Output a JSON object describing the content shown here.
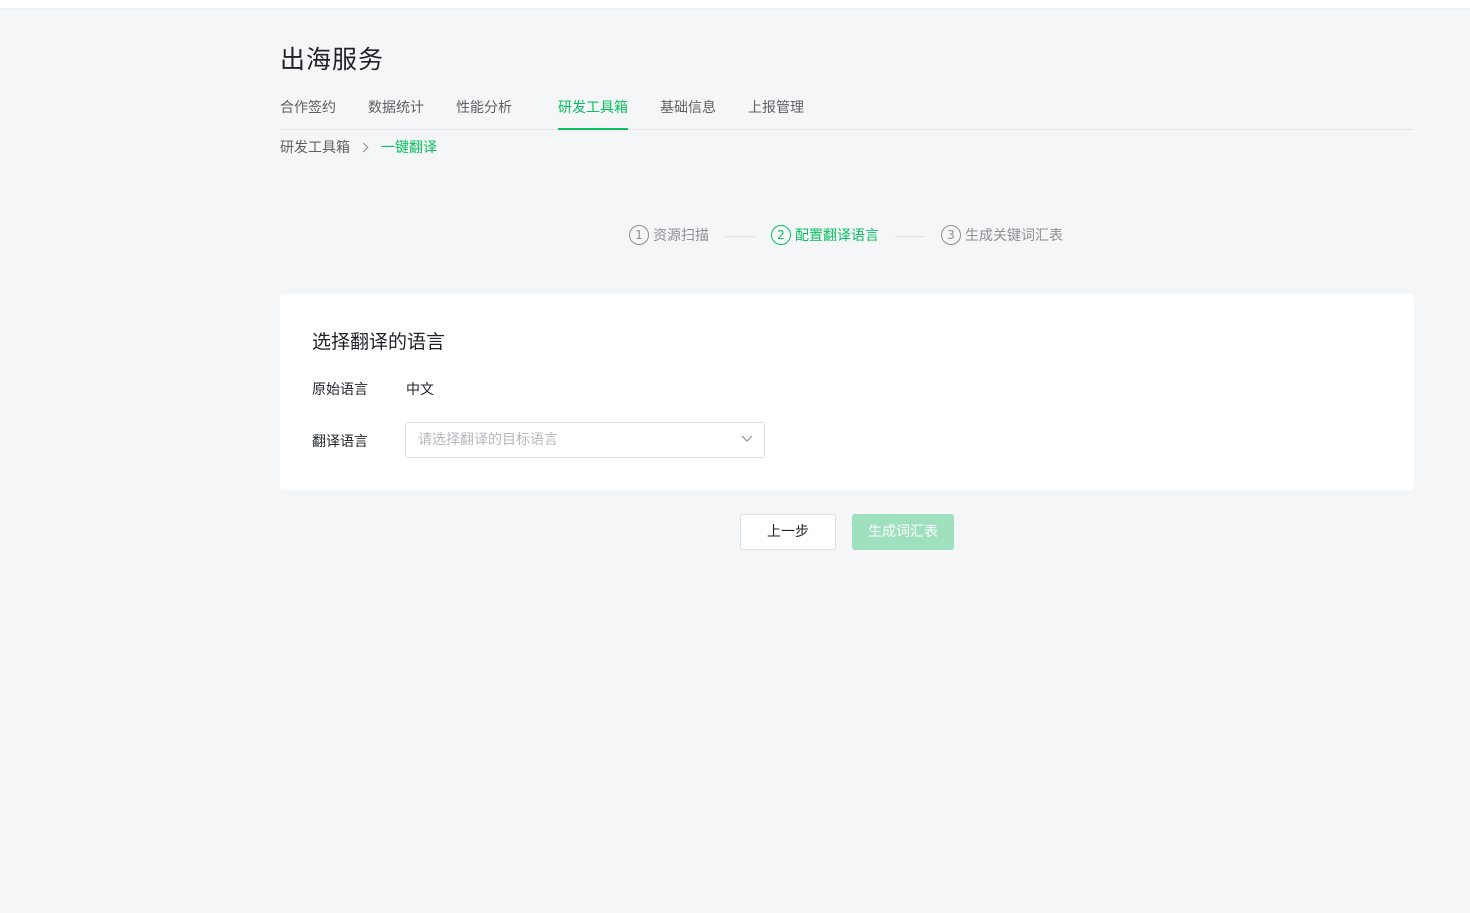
{
  "page": {
    "title": "出海服务"
  },
  "tabs": [
    {
      "label": "合作签约"
    },
    {
      "label": "数据统计"
    },
    {
      "label": "性能分析"
    },
    {
      "label": "研发工具箱"
    },
    {
      "label": "基础信息"
    },
    {
      "label": "上报管理"
    }
  ],
  "active_tab": "研发工具箱",
  "breadcrumb": {
    "parent": "研发工具箱",
    "current": "一键翻译"
  },
  "steps": [
    {
      "number": "1",
      "label": "资源扫描",
      "state": "done"
    },
    {
      "number": "2",
      "label": "配置翻译语言",
      "state": "active"
    },
    {
      "number": "3",
      "label": "生成关键词汇表",
      "state": "pending"
    }
  ],
  "card": {
    "title": "选择翻译的语言",
    "source_label": "原始语言",
    "source_value": "中文",
    "target_label": "翻译语言",
    "target_placeholder": "请选择翻译的目标语言"
  },
  "buttons": {
    "prev": "上一步",
    "generate": "生成词汇表"
  },
  "colors": {
    "accent": "#07c160",
    "accent_disabled": "#9be0bc",
    "background": "#f5f6f7"
  },
  "icons": {
    "breadcrumb_separator": "chevron-right-icon",
    "select_arrow": "chevron-down-icon"
  }
}
